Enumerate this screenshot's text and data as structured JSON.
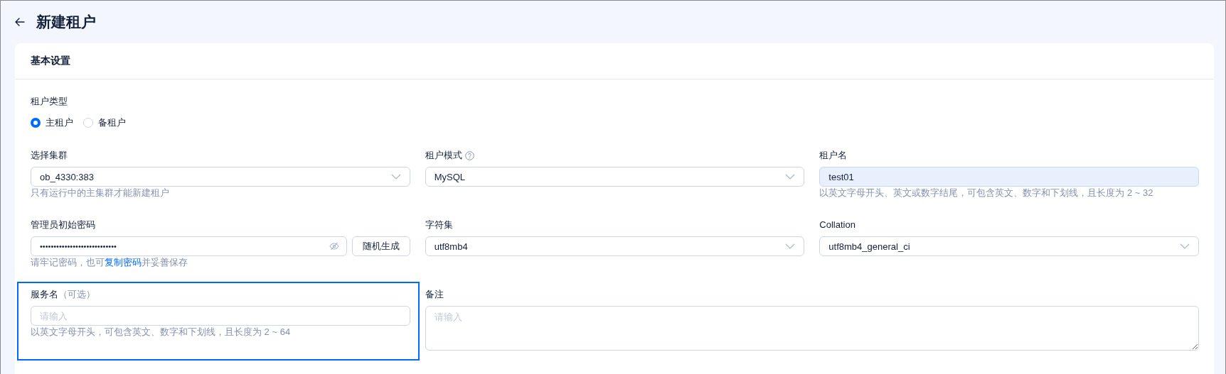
{
  "page": {
    "title": "新建租户"
  },
  "section": {
    "title": "基本设置"
  },
  "tenant_type": {
    "label": "租户类型",
    "options": [
      {
        "label": "主租户",
        "selected": true
      },
      {
        "label": "备租户",
        "selected": false
      }
    ]
  },
  "fields": [
    {
      "kind": "select",
      "label": "选择集群",
      "value": "ob_4330:383",
      "hint": "只有运行中的主集群才能新建租户"
    },
    {
      "kind": "select",
      "label": "租户模式",
      "help": true,
      "value": "MySQL"
    },
    {
      "kind": "text",
      "label": "租户名",
      "value": "test01",
      "hint": "以英文字母开头、英文或数字结尾，可包含英文、数字和下划线，且长度为 2 ~ 32"
    },
    {
      "kind": "password",
      "label": "管理员初始密码",
      "value": "••••••••••••••••••••••••••••",
      "button": "随机生成",
      "hint": "请牢记密码，也可",
      "hint_link": "复制密码",
      "hint_after": "并妥善保存"
    },
    {
      "kind": "select",
      "label": "字符集",
      "value": "utf8mb4"
    },
    {
      "kind": "select",
      "label": "Collation",
      "value": "utf8mb4_general_ci"
    },
    {
      "kind": "text",
      "label": "服务名",
      "optional": "（可选）",
      "placeholder": "请输入",
      "hint": "以英文字母开头，可包含英文、数字和下划线，且长度为 2 ~ 64",
      "highlighted": true
    },
    {
      "kind": "textarea",
      "label": "备注",
      "placeholder": "请输入"
    }
  ]
}
